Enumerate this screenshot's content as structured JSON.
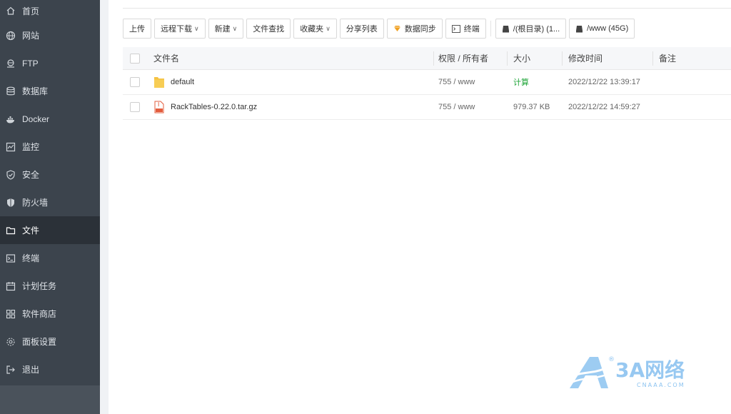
{
  "sidebar": {
    "items": [
      {
        "label": "首页",
        "icon": "home-icon"
      },
      {
        "label": "网站",
        "icon": "globe-icon"
      },
      {
        "label": "FTP",
        "icon": "ftp-icon"
      },
      {
        "label": "数据库",
        "icon": "database-icon"
      },
      {
        "label": "Docker",
        "icon": "docker-icon"
      },
      {
        "label": "监控",
        "icon": "monitor-icon"
      },
      {
        "label": "安全",
        "icon": "shield-check-icon"
      },
      {
        "label": "防火墙",
        "icon": "firewall-icon"
      },
      {
        "label": "文件",
        "icon": "folder-icon",
        "active": true
      },
      {
        "label": "终端",
        "icon": "terminal-icon"
      },
      {
        "label": "计划任务",
        "icon": "calendar-icon"
      },
      {
        "label": "软件商店",
        "icon": "apps-icon"
      },
      {
        "label": "面板设置",
        "icon": "gear-icon"
      },
      {
        "label": "退出",
        "icon": "logout-icon"
      }
    ]
  },
  "toolbar": {
    "upload": "上传",
    "remote_download": "远程下载",
    "new": "新建",
    "file_search": "文件查找",
    "favorites": "收藏夹",
    "share_list": "分享列表",
    "data_sync": "数据同步",
    "terminal": "终端",
    "disk_root": "/(根目录) (1...",
    "disk_www": "/www (45G)"
  },
  "table": {
    "headers": {
      "name": "文件名",
      "perm": "权限 / 所有者",
      "size": "大小",
      "mtime": "修改时间",
      "note": "备注"
    },
    "rows": [
      {
        "name": "default",
        "perm": "755 / www",
        "size": "计算",
        "mtime": "2022/12/22 13:39:17",
        "type": "folder"
      },
      {
        "name": "RackTables-0.22.0.tar.gz",
        "perm": "755 / www",
        "size": "979.37 KB",
        "mtime": "2022/12/22 14:59:27",
        "type": "archive"
      }
    ]
  },
  "watermark": {
    "brand": "3A网络",
    "domain": "CNAAA.COM",
    "registered": "®"
  },
  "colors": {
    "sidebar_bg": "#3c444d",
    "sidebar_active": "#2b3138",
    "accent_green": "#20a53a",
    "folder_yellow": "#f5c242",
    "logo_blue": "#8cc3f0"
  }
}
